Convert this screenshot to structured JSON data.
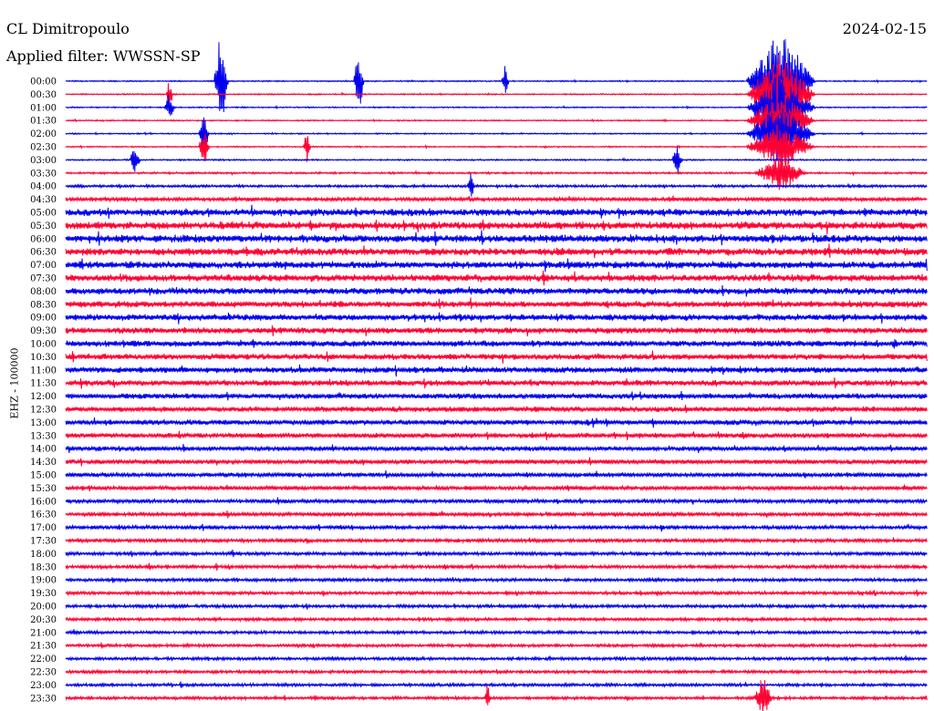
{
  "header": {
    "station": "CL Dimitropoulo",
    "filter": "Applied filter: WWSSN-SP",
    "date": "2024-02-15"
  },
  "chart_data": {
    "type": "line",
    "title": "CL Dimitropoulo",
    "subtitle": "Applied filter: WWSSN-SP",
    "date": "2024-02-15",
    "ylabel": "EHZ - 100000",
    "xlabel": "",
    "row_interval_minutes": 30,
    "tick_labels": [
      "00:00",
      "00:30",
      "01:00",
      "01:30",
      "02:00",
      "02:30",
      "03:00",
      "03:30",
      "04:00",
      "04:30",
      "05:00",
      "05:30",
      "06:00",
      "06:30",
      "07:00",
      "07:30",
      "08:00",
      "08:30",
      "09:00",
      "09:30",
      "10:00",
      "10:30",
      "11:00",
      "11:30",
      "12:00",
      "12:30",
      "13:00",
      "13:30",
      "14:00",
      "14:30",
      "15:00",
      "15:30",
      "16:00",
      "16:30",
      "17:00",
      "17:30",
      "18:00",
      "18:30",
      "19:00",
      "19:30",
      "20:00",
      "20:30",
      "21:00",
      "21:30",
      "22:00",
      "22:30",
      "23:00",
      "23:30"
    ],
    "series_colors": [
      "#0000ee",
      "#ff0033"
    ],
    "noise_level": [
      0.6,
      0.6,
      0.6,
      0.6,
      0.6,
      0.6,
      0.7,
      0.9,
      1.2,
      1.8,
      3.4,
      3.6,
      3.6,
      3.5,
      3.4,
      3.3,
      3.1,
      3.0,
      3.0,
      2.9,
      2.9,
      2.8,
      2.8,
      2.7,
      2.6,
      2.5,
      2.4,
      2.3,
      2.2,
      2.1,
      2.0,
      1.9,
      1.8,
      1.8,
      1.7,
      1.7,
      1.6,
      1.6,
      1.5,
      1.5,
      1.5,
      1.4,
      1.4,
      1.4,
      1.4,
      1.4,
      1.4,
      1.4
    ],
    "events": [
      {
        "row": 0,
        "x": 0.18,
        "amp": 9,
        "width": 0.008
      },
      {
        "row": 0,
        "x": 0.34,
        "amp": 6,
        "width": 0.006
      },
      {
        "row": 0,
        "x": 0.51,
        "amp": 3,
        "width": 0.004
      },
      {
        "row": 0,
        "x": 0.83,
        "amp": 9,
        "width": 0.04
      },
      {
        "row": 1,
        "x": 0.12,
        "amp": 2.5,
        "width": 0.004
      },
      {
        "row": 1,
        "x": 0.83,
        "amp": 7,
        "width": 0.04
      },
      {
        "row": 2,
        "x": 0.12,
        "amp": 2.5,
        "width": 0.006
      },
      {
        "row": 2,
        "x": 0.83,
        "amp": 6,
        "width": 0.04
      },
      {
        "row": 3,
        "x": 0.83,
        "amp": 5,
        "width": 0.04
      },
      {
        "row": 4,
        "x": 0.16,
        "amp": 4,
        "width": 0.006
      },
      {
        "row": 4,
        "x": 0.83,
        "amp": 5,
        "width": 0.04
      },
      {
        "row": 5,
        "x": 0.16,
        "amp": 4,
        "width": 0.006
      },
      {
        "row": 5,
        "x": 0.28,
        "amp": 3,
        "width": 0.004
      },
      {
        "row": 5,
        "x": 0.83,
        "amp": 4,
        "width": 0.04
      },
      {
        "row": 6,
        "x": 0.08,
        "amp": 2.5,
        "width": 0.006
      },
      {
        "row": 6,
        "x": 0.71,
        "amp": 2.5,
        "width": 0.006
      },
      {
        "row": 7,
        "x": 0.83,
        "amp": 3,
        "width": 0.03
      },
      {
        "row": 8,
        "x": 0.47,
        "amp": 3,
        "width": 0.004
      },
      {
        "row": 47,
        "x": 0.49,
        "amp": 2.5,
        "width": 0.003
      },
      {
        "row": 47,
        "x": 0.81,
        "amp": 4,
        "width": 0.01
      }
    ]
  }
}
